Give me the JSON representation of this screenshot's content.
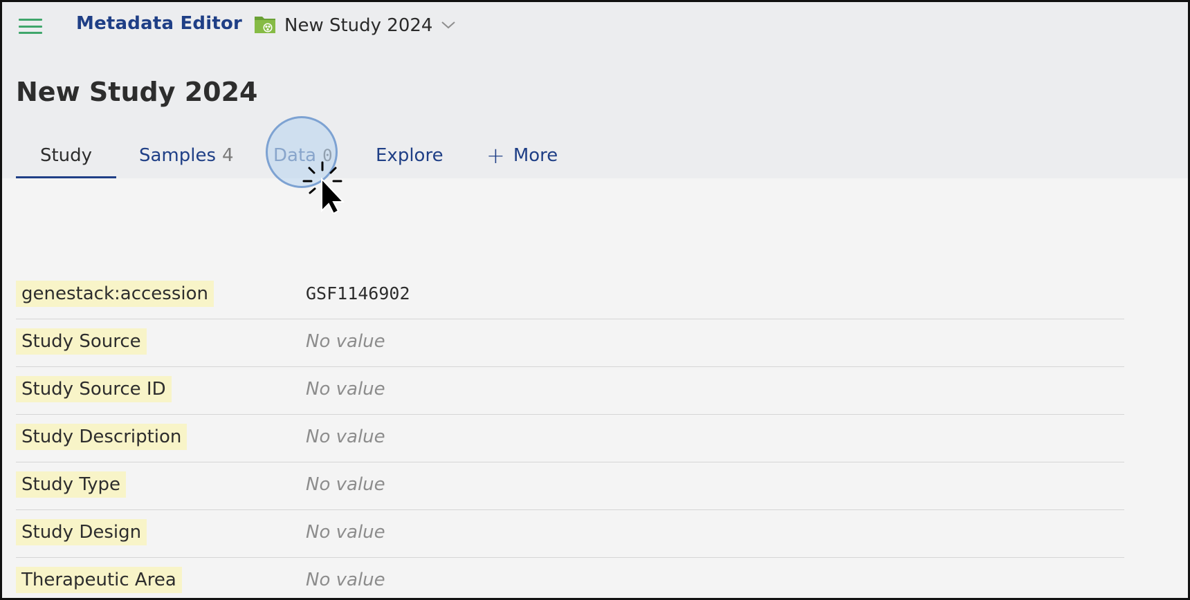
{
  "app": {
    "title": "Metadata Editor"
  },
  "breadcrumb": {
    "label": "New Study 2024"
  },
  "page": {
    "title": "New Study 2024"
  },
  "tabs": [
    {
      "label": "Study",
      "count": ""
    },
    {
      "label": "Samples",
      "count": "4"
    },
    {
      "label": "Data",
      "count": "0"
    },
    {
      "label": "Explore",
      "count": ""
    },
    {
      "label": "More",
      "count": ""
    }
  ],
  "fields": [
    {
      "key": "genestack:accession",
      "value": "GSF1146902"
    },
    {
      "key": "Study Source",
      "value": "No value"
    },
    {
      "key": "Study Source ID",
      "value": "No value"
    },
    {
      "key": "Study Description",
      "value": "No value"
    },
    {
      "key": "Study Type",
      "value": "No value"
    },
    {
      "key": "Study Design",
      "value": "No value"
    },
    {
      "key": "Therapeutic Area",
      "value": "No value"
    }
  ],
  "icons": {
    "menu": "hamburger-icon",
    "folder": "study-folder-icon",
    "dropdown": "chevron-down-icon",
    "add": "plus-icon"
  },
  "colors": {
    "brand": "#1f3f86",
    "menu_icon": "#3fa66b",
    "key_highlight": "#f8f4c8"
  }
}
